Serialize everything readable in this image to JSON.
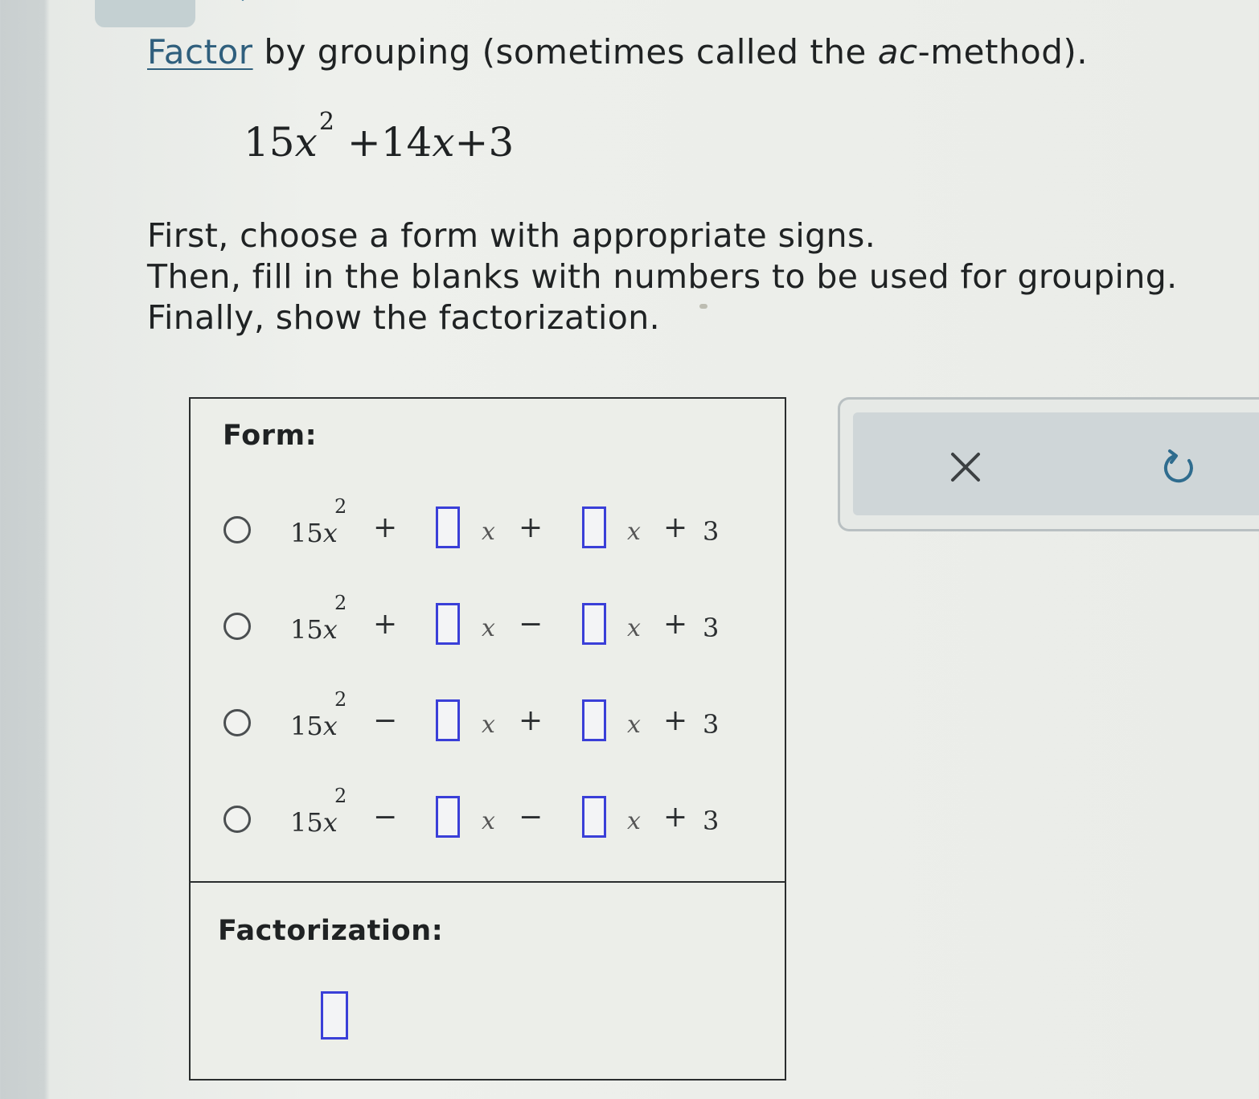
{
  "prompt": {
    "link": "Factor",
    "before_ac": " by grouping (sometimes called the ",
    "ac": "ac",
    "after_ac": "-method)."
  },
  "expression": {
    "coef": "15",
    "var": "x",
    "power": "2",
    "rest_op1": " +14",
    "rest_var": "x",
    "rest_tail": "+3"
  },
  "instructions": [
    "First, choose a form with appropriate signs.",
    "Then, fill in the blanks with numbers to be used for grouping.",
    "Finally, show the factorization."
  ],
  "form": {
    "title": "Form:",
    "lead_coef": "15",
    "lead_var": "x",
    "lead_power": "2",
    "var": "x",
    "constant_sign": "+",
    "constant": "3",
    "options": [
      {
        "sign1": "+",
        "sign2": "+"
      },
      {
        "sign1": "+",
        "sign2": "−"
      },
      {
        "sign1": "−",
        "sign2": "+"
      },
      {
        "sign1": "−",
        "sign2": "−"
      }
    ]
  },
  "factorization": {
    "title": "Factorization:"
  },
  "tools": {
    "clear_icon": "x-icon",
    "undo_icon": "undo-icon"
  }
}
